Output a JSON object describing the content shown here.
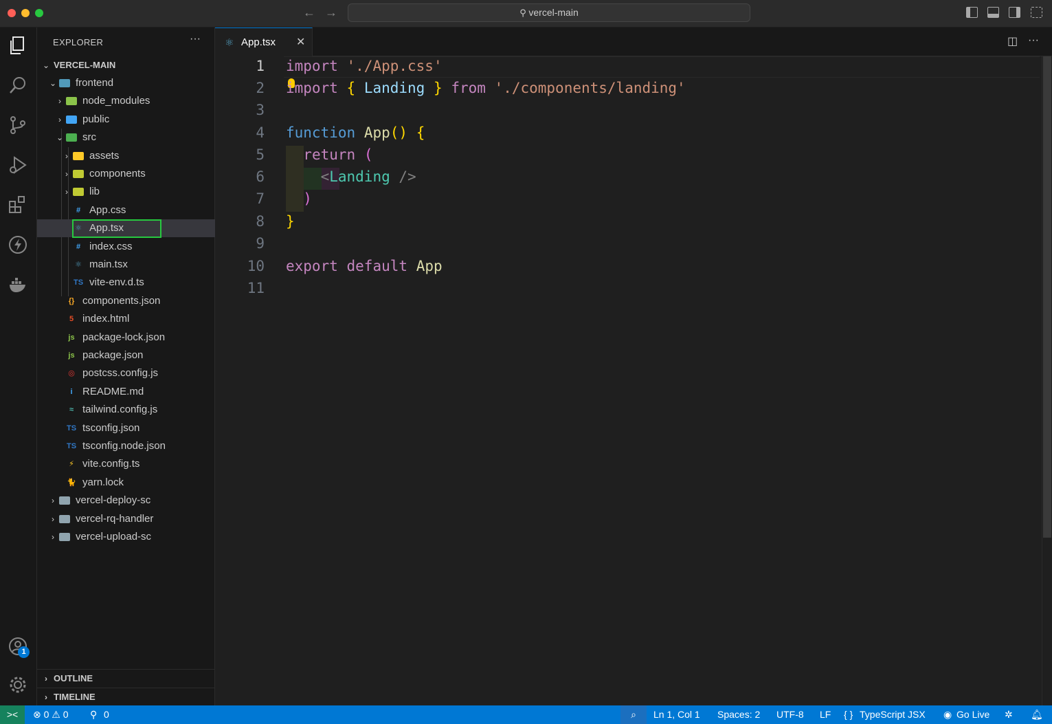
{
  "titlebar": {
    "search_text": "vercel-main",
    "back_icon": "←",
    "forward_icon": "→"
  },
  "explorer": {
    "title": "EXPLORER",
    "more": "···",
    "root": "VERCEL-MAIN",
    "rows": [
      {
        "label": "frontend",
        "kind": "folder-open",
        "color": "#519aba"
      },
      {
        "label": "node_modules",
        "kind": "folder",
        "color": "#8bc34a"
      },
      {
        "label": "public",
        "kind": "folder",
        "color": "#42a5f5"
      },
      {
        "label": "src",
        "kind": "folder-open",
        "color": "#4caf50"
      },
      {
        "label": "assets",
        "kind": "folder",
        "color": "#ffca28"
      },
      {
        "label": "components",
        "kind": "folder",
        "color": "#c0ca33"
      },
      {
        "label": "lib",
        "kind": "folder",
        "color": "#c0ca33"
      },
      {
        "label": "App.css",
        "kind": "file",
        "color": "#42a5f5",
        "glyph": "#"
      },
      {
        "label": "App.tsx",
        "kind": "file",
        "color": "#519aba",
        "glyph": "⚛"
      },
      {
        "label": "index.css",
        "kind": "file",
        "color": "#42a5f5",
        "glyph": "#"
      },
      {
        "label": "main.tsx",
        "kind": "file",
        "color": "#519aba",
        "glyph": "⚛"
      },
      {
        "label": "vite-env.d.ts",
        "kind": "file",
        "color": "#3178c6",
        "glyph": "TS"
      },
      {
        "label": "components.json",
        "kind": "file",
        "color": "#f9a825",
        "glyph": "{}"
      },
      {
        "label": "index.html",
        "kind": "file",
        "color": "#e44d26",
        "glyph": "5"
      },
      {
        "label": "package-lock.json",
        "kind": "file",
        "color": "#8bc34a",
        "glyph": "js"
      },
      {
        "label": "package.json",
        "kind": "file",
        "color": "#8bc34a",
        "glyph": "js"
      },
      {
        "label": "postcss.config.js",
        "kind": "file",
        "color": "#e53935",
        "glyph": "◎"
      },
      {
        "label": "README.md",
        "kind": "file",
        "color": "#42a5f5",
        "glyph": "i"
      },
      {
        "label": "tailwind.config.js",
        "kind": "file",
        "color": "#4db6ac",
        "glyph": "≈"
      },
      {
        "label": "tsconfig.json",
        "kind": "file",
        "color": "#3178c6",
        "glyph": "TS"
      },
      {
        "label": "tsconfig.node.json",
        "kind": "file",
        "color": "#3178c6",
        "glyph": "TS"
      },
      {
        "label": "vite.config.ts",
        "kind": "file",
        "color": "#ffca28",
        "glyph": "⚡"
      },
      {
        "label": "yarn.lock",
        "kind": "file",
        "color": "#2188b6",
        "glyph": "🐈"
      },
      {
        "label": "vercel-deploy-sc",
        "kind": "folder",
        "color": "#90a4ae"
      },
      {
        "label": "vercel-rq-handler",
        "kind": "folder",
        "color": "#90a4ae"
      },
      {
        "label": "vercel-upload-sc",
        "kind": "folder",
        "color": "#90a4ae"
      }
    ],
    "outline": "OUTLINE",
    "timeline": "TIMELINE"
  },
  "tab": {
    "label": "App.tsx",
    "close": "✕"
  },
  "editor": {
    "line_numbers": [
      "1",
      "2",
      "3",
      "4",
      "5",
      "6",
      "7",
      "8",
      "9",
      "10",
      "11"
    ],
    "l1_kw": "import",
    "l1_str": "'./App.css'",
    "l2_kw": "import",
    "l2_open": "{",
    "l2_name": "Landing",
    "l2_close": "}",
    "l2_from": "from",
    "l2_str": "'./components/landing'",
    "l4_kw": "function",
    "l4_name": "App",
    "l4_parens": "()",
    "l4_brace": "{",
    "l5_kw": "return",
    "l5_paren": "(",
    "l6_lt": "<",
    "l6_tag": "Landing",
    "l6_end": "/>",
    "l7_paren": ")",
    "l8_brace": "}",
    "l10_kw1": "export",
    "l10_kw2": "default",
    "l10_name": "App"
  },
  "status": {
    "remote": "><",
    "errors": "⊗ 0 ⚠ 0",
    "ports": "0",
    "position": "Ln 1, Col 1",
    "spaces": "Spaces: 2",
    "encoding": "UTF-8",
    "eol": "LF",
    "language": "TypeScript JSX",
    "golive": "Go Live"
  },
  "accounts_badge": "1",
  "colors": {
    "accent": "#0078d4",
    "selection_outline": "#27c93f"
  }
}
